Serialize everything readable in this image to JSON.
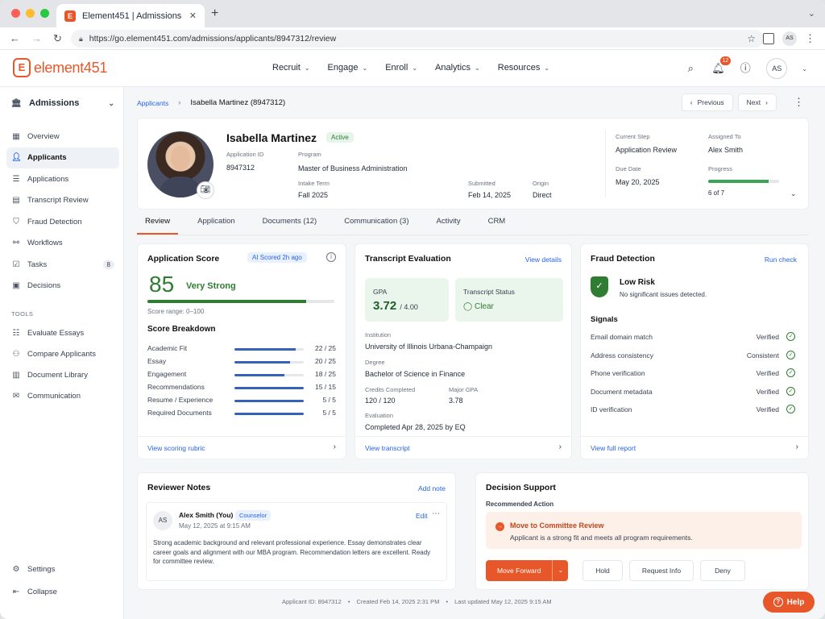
{
  "browser": {
    "tab_title": "Element451 | Admissions",
    "favicon_letter": "E",
    "url": "https://go.element451.com/admissions/applicants/8947312/review",
    "profile_initials": "AS"
  },
  "header": {
    "logo_letter": "E",
    "logo_text": "element451",
    "nav": [
      "Recruit",
      "Engage",
      "Enroll",
      "Analytics",
      "Resources"
    ],
    "notification_count": "12",
    "avatar_initials": "AS"
  },
  "sidebar": {
    "org": "Admissions",
    "items": [
      {
        "label": "Overview",
        "icon": "grid-icon"
      },
      {
        "label": "Applicants",
        "icon": "person-icon",
        "active": true
      },
      {
        "label": "Applications",
        "icon": "list-icon"
      },
      {
        "label": "Transcript Review",
        "icon": "doc-icon"
      },
      {
        "label": "Fraud Detection",
        "icon": "shield-icon"
      },
      {
        "label": "Workflows",
        "icon": "flow-icon"
      },
      {
        "label": "Tasks",
        "icon": "check-icon",
        "count": "8"
      },
      {
        "label": "Decisions",
        "icon": "clipboard-icon"
      }
    ],
    "tools_heading": "TOOLS",
    "tools": [
      {
        "label": "Evaluate Essays",
        "icon": "list-icon"
      },
      {
        "label": "Compare Applicants",
        "icon": "people-icon"
      },
      {
        "label": "Document Library",
        "icon": "doc-icon"
      },
      {
        "label": "Communication",
        "icon": "chat-icon"
      }
    ],
    "settings": "Settings",
    "collapse": "Collapse"
  },
  "breadcrumb": {
    "root": "Applicants",
    "current": "Isabella Martinez (8947312)"
  },
  "pager": {
    "previous": "Previous",
    "next": "Next"
  },
  "profile": {
    "name": "Isabella Martinez",
    "status": "Active",
    "application_id_label": "Application ID",
    "application_id": "8947312",
    "program_label": "Program",
    "program": "Master of Business Administration",
    "intake_label": "Intake Term",
    "intake": "Fall 2025",
    "submitted_label": "Submitted",
    "submitted": "Feb 14, 2025",
    "origin_label": "Origin",
    "origin": "Direct",
    "current_step_label": "Current Step",
    "current_step": "Application Review",
    "assigned_label": "Assigned To",
    "assigned": "Alex Smith",
    "due_label": "Due Date",
    "due": "May 20, 2025",
    "progress_label": "Progress",
    "progress_text": "6 of 7",
    "progress_fraction": 0.857
  },
  "tabs": [
    "Review",
    "Application",
    "Documents (12)",
    "Communication (3)",
    "Activity",
    "CRM"
  ],
  "score_card": {
    "title": "Application Score",
    "ai_badge": "AI Scored 2h ago",
    "score": "85",
    "score_value": 85,
    "score_label": "Very Strong",
    "range": "Score range: 0–100",
    "breakdown_title": "Score Breakdown",
    "breakdown": [
      {
        "name": "Academic Fit",
        "value": "22 / 25",
        "fraction": 0.88
      },
      {
        "name": "Essay",
        "value": "20 / 25",
        "fraction": 0.8
      },
      {
        "name": "Engagement",
        "value": "18 / 25",
        "fraction": 0.72
      },
      {
        "name": "Recommendations",
        "value": "15 / 15",
        "fraction": 1.0
      },
      {
        "name": "Resume / Experience",
        "value": "5 / 5",
        "fraction": 1.0
      },
      {
        "name": "Required Documents",
        "value": "5 / 5",
        "fraction": 1.0
      }
    ],
    "footer_link": "View scoring rubric"
  },
  "transcript_card": {
    "title": "Transcript Evaluation",
    "view_details": "View details",
    "gpa_label": "GPA",
    "gpa": "3.72",
    "gpa_max": "/ 4.00",
    "status_label": "Transcript Status",
    "status": "Clear",
    "institution_label": "Institution",
    "institution": "University of Illinois Urbana-Champaign",
    "degree_label": "Degree",
    "degree": "Bachelor of Science in Finance",
    "credits_label": "Credits Completed",
    "credits": "120 / 120",
    "major_gpa_label": "Major GPA",
    "major_gpa": "3.78",
    "evaluation_label": "Evaluation",
    "evaluation": "Completed Apr 28, 2025 by EQ",
    "footer_link": "View transcript"
  },
  "fraud_card": {
    "title": "Fraud Detection",
    "run_check": "Run check",
    "risk": "Low Risk",
    "risk_sub": "No significant issues detected.",
    "signals_title": "Signals",
    "signals": [
      {
        "name": "Email domain match",
        "status": "Verified"
      },
      {
        "name": "Address consistency",
        "status": "Consistent"
      },
      {
        "name": "Phone verification",
        "status": "Verified"
      },
      {
        "name": "Document metadata",
        "status": "Verified"
      },
      {
        "name": "ID verification",
        "status": "Verified"
      }
    ],
    "footer_link": "View full report"
  },
  "notes_card": {
    "title": "Reviewer Notes",
    "add_note": "Add note",
    "avatar": "AS",
    "author": "Alex Smith (You)",
    "role": "Counselor",
    "date": "May 12, 2025 at 9:15 AM",
    "edit": "Edit",
    "text": "Strong academic background and relevant professional experience. Essay demonstrates clear career goals and alignment with our MBA program. Recommendation letters are excellent. Ready for committee review."
  },
  "decision_card": {
    "title": "Decision Support",
    "recommended_label": "Recommended Action",
    "rec_title": "Move to Committee Review",
    "rec_sub": "Applicant is a strong fit and meets all program requirements.",
    "move_forward": "Move Forward",
    "hold": "Hold",
    "request_info": "Request Info",
    "deny": "Deny"
  },
  "footer": {
    "applicant_id": "Applicant ID: 8947312",
    "created": "Created Feb 14, 2025 2:31 PM",
    "updated": "Last updated May 12, 2025 9:15 AM"
  },
  "help": "Help"
}
